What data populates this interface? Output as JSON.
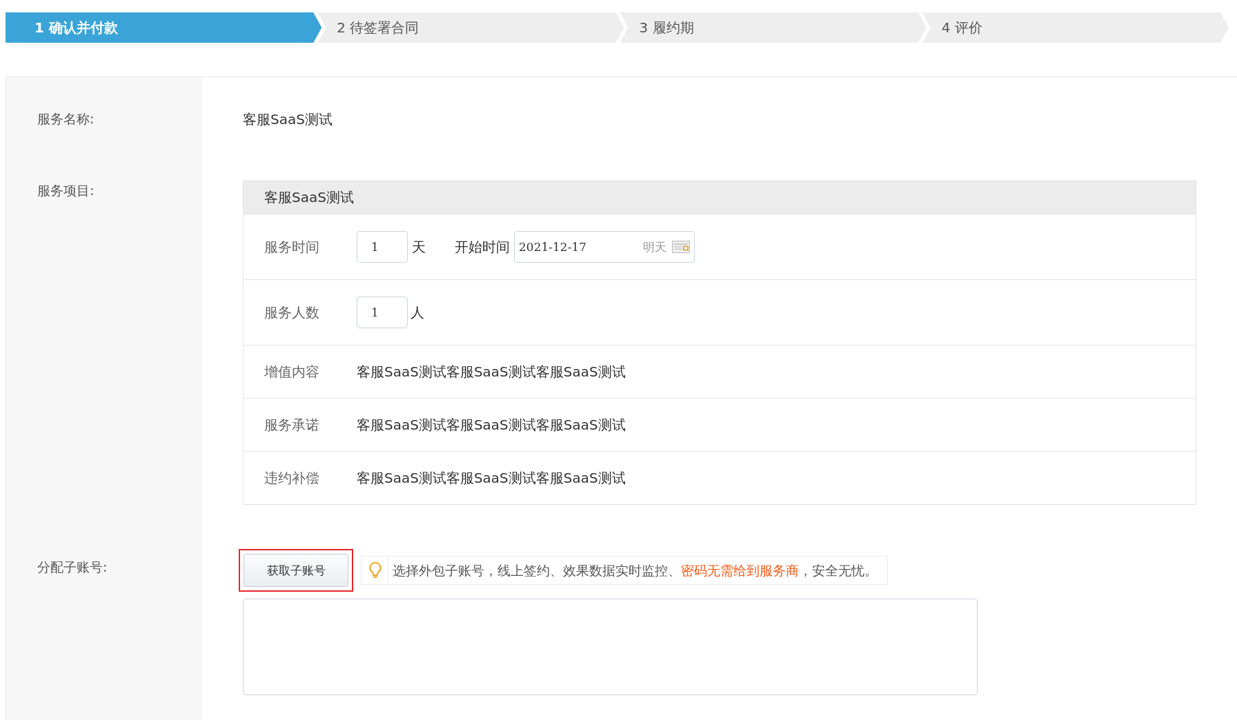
{
  "steps": [
    {
      "label": "1 确认并付款",
      "selected": true
    },
    {
      "label": "2 待签署合同",
      "selected": false
    },
    {
      "label": "3 履约期",
      "selected": false
    },
    {
      "label": "4 评价",
      "selected": false
    }
  ],
  "service_name": {
    "label": "服务名称:",
    "value": "客服SaaS测试"
  },
  "service_items": {
    "label": "服务项目:",
    "header": "客服SaaS测试",
    "rows": [
      {
        "kind": "duration",
        "label": "服务时间",
        "value": "1",
        "unit": "天",
        "start_label": "开始时间",
        "start_date": "2021-12-17",
        "date_hint": "明天"
      },
      {
        "kind": "count",
        "label": "服务人数",
        "value": "1",
        "unit": "人"
      },
      {
        "kind": "text",
        "label": "增值内容",
        "value": "客服SaaS测试客服SaaS测试客服SaaS测试"
      },
      {
        "kind": "text",
        "label": "服务承诺",
        "value": "客服SaaS测试客服SaaS测试客服SaaS测试"
      },
      {
        "kind": "text",
        "label": "违约补偿",
        "value": "客服SaaS测试客服SaaS测试客服SaaS测试"
      }
    ]
  },
  "sub_account": {
    "label": "分配子账号:",
    "button": "获取子账号",
    "button_highlighted": true,
    "tip": [
      {
        "text": "选择外包子账号，线上签约、效果数据实时监控、",
        "emphasis": false
      },
      {
        "text": "密码无需给到服务商",
        "emphasis": true
      },
      {
        "text": "，安全无忧。",
        "emphasis": false
      }
    ]
  }
}
